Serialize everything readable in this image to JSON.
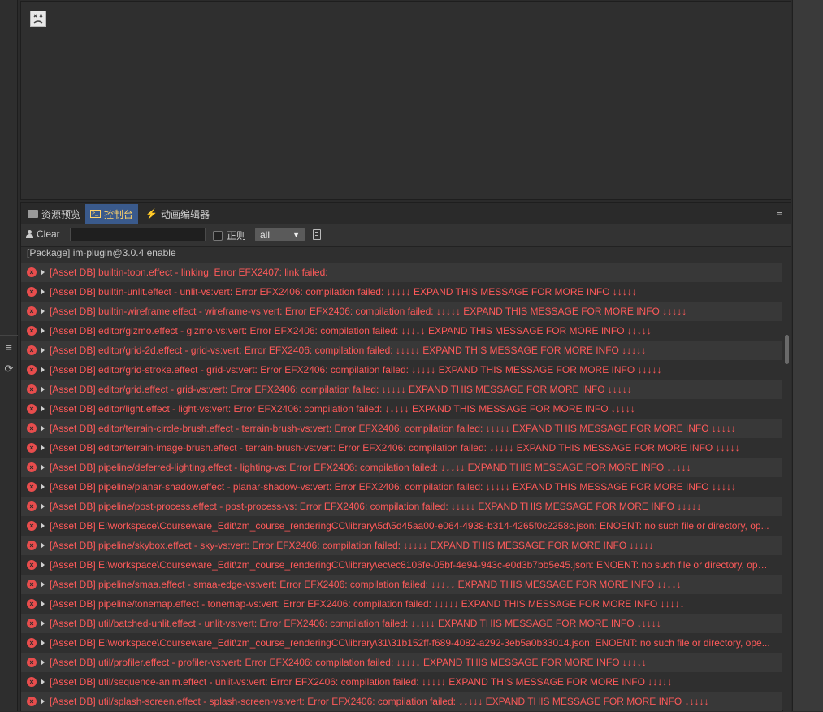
{
  "tabs": [
    {
      "label": "资源预览",
      "icon": "folder-icon"
    },
    {
      "label": "控制台",
      "icon": "console-icon"
    },
    {
      "label": "动画编辑器",
      "icon": "animation-icon"
    }
  ],
  "toolbar": {
    "clear_label": "Clear",
    "search_value": "",
    "regex_label": "正则",
    "filter_selected": "all",
    "menu_glyph": "≡"
  },
  "logs": [
    {
      "type": "info",
      "text": "[Package] im-plugin@3.0.4 enable"
    },
    {
      "type": "error",
      "text": "[Asset DB] builtin-toon.effect - linking: Error EFX2407: link failed:"
    },
    {
      "type": "error",
      "text": "[Asset DB] builtin-unlit.effect - unlit-vs:vert: Error EFX2406: compilation failed: ↓↓↓↓↓ EXPAND THIS MESSAGE FOR MORE INFO ↓↓↓↓↓"
    },
    {
      "type": "error",
      "text": "[Asset DB] builtin-wireframe.effect - wireframe-vs:vert: Error EFX2406: compilation failed: ↓↓↓↓↓ EXPAND THIS MESSAGE FOR MORE INFO ↓↓↓↓↓"
    },
    {
      "type": "error",
      "text": "[Asset DB] editor/gizmo.effect - gizmo-vs:vert: Error EFX2406: compilation failed: ↓↓↓↓↓ EXPAND THIS MESSAGE FOR MORE INFO ↓↓↓↓↓"
    },
    {
      "type": "error",
      "text": "[Asset DB] editor/grid-2d.effect - grid-vs:vert: Error EFX2406: compilation failed: ↓↓↓↓↓ EXPAND THIS MESSAGE FOR MORE INFO ↓↓↓↓↓"
    },
    {
      "type": "error",
      "text": "[Asset DB] editor/grid-stroke.effect - grid-vs:vert: Error EFX2406: compilation failed: ↓↓↓↓↓ EXPAND THIS MESSAGE FOR MORE INFO ↓↓↓↓↓"
    },
    {
      "type": "error",
      "text": "[Asset DB] editor/grid.effect - grid-vs:vert: Error EFX2406: compilation failed: ↓↓↓↓↓ EXPAND THIS MESSAGE FOR MORE INFO ↓↓↓↓↓"
    },
    {
      "type": "error",
      "text": "[Asset DB] editor/light.effect - light-vs:vert: Error EFX2406: compilation failed: ↓↓↓↓↓ EXPAND THIS MESSAGE FOR MORE INFO ↓↓↓↓↓"
    },
    {
      "type": "error",
      "text": "[Asset DB] editor/terrain-circle-brush.effect - terrain-brush-vs:vert: Error EFX2406: compilation failed: ↓↓↓↓↓ EXPAND THIS MESSAGE FOR MORE INFO ↓↓↓↓↓"
    },
    {
      "type": "error",
      "text": "[Asset DB] editor/terrain-image-brush.effect - terrain-brush-vs:vert: Error EFX2406: compilation failed: ↓↓↓↓↓ EXPAND THIS MESSAGE FOR MORE INFO ↓↓↓↓↓"
    },
    {
      "type": "error",
      "text": "[Asset DB] pipeline/deferred-lighting.effect - lighting-vs: Error EFX2406: compilation failed: ↓↓↓↓↓ EXPAND THIS MESSAGE FOR MORE INFO ↓↓↓↓↓"
    },
    {
      "type": "error",
      "text": "[Asset DB] pipeline/planar-shadow.effect - planar-shadow-vs:vert: Error EFX2406: compilation failed: ↓↓↓↓↓ EXPAND THIS MESSAGE FOR MORE INFO ↓↓↓↓↓"
    },
    {
      "type": "error",
      "text": "[Asset DB] pipeline/post-process.effect - post-process-vs: Error EFX2406: compilation failed: ↓↓↓↓↓ EXPAND THIS MESSAGE FOR MORE INFO ↓↓↓↓↓"
    },
    {
      "type": "error",
      "text": "[Asset DB] E:\\workspace\\Courseware_Edit\\zm_course_renderingCC\\library\\5d\\5d45aa00-e064-4938-b314-4265f0c2258c.json: ENOENT: no such file or directory, op..."
    },
    {
      "type": "error",
      "text": "[Asset DB] pipeline/skybox.effect - sky-vs:vert: Error EFX2406: compilation failed: ↓↓↓↓↓ EXPAND THIS MESSAGE FOR MORE INFO ↓↓↓↓↓"
    },
    {
      "type": "error",
      "text": "[Asset DB] E:\\workspace\\Courseware_Edit\\zm_course_renderingCC\\library\\ec\\ec8106fe-05bf-4e94-943c-e0d3b7bb5e45.json: ENOENT: no such file or directory, ope..."
    },
    {
      "type": "error",
      "text": "[Asset DB] pipeline/smaa.effect - smaa-edge-vs:vert: Error EFX2406: compilation failed: ↓↓↓↓↓ EXPAND THIS MESSAGE FOR MORE INFO ↓↓↓↓↓"
    },
    {
      "type": "error",
      "text": "[Asset DB] pipeline/tonemap.effect - tonemap-vs:vert: Error EFX2406: compilation failed: ↓↓↓↓↓ EXPAND THIS MESSAGE FOR MORE INFO ↓↓↓↓↓"
    },
    {
      "type": "error",
      "text": "[Asset DB] util/batched-unlit.effect - unlit-vs:vert: Error EFX2406: compilation failed: ↓↓↓↓↓ EXPAND THIS MESSAGE FOR MORE INFO ↓↓↓↓↓"
    },
    {
      "type": "error",
      "text": "[Asset DB] E:\\workspace\\Courseware_Edit\\zm_course_renderingCC\\library\\31\\31b152ff-f689-4082-a292-3eb5a0b33014.json: ENOENT: no such file or directory, ope..."
    },
    {
      "type": "error",
      "text": "[Asset DB] util/profiler.effect - profiler-vs:vert: Error EFX2406: compilation failed: ↓↓↓↓↓ EXPAND THIS MESSAGE FOR MORE INFO ↓↓↓↓↓"
    },
    {
      "type": "error",
      "text": "[Asset DB] util/sequence-anim.effect - unlit-vs:vert: Error EFX2406: compilation failed: ↓↓↓↓↓ EXPAND THIS MESSAGE FOR MORE INFO ↓↓↓↓↓"
    },
    {
      "type": "error",
      "text": "[Asset DB] util/splash-screen.effect - splash-screen-vs:vert: Error EFX2406: compilation failed: ↓↓↓↓↓ EXPAND THIS MESSAGE FOR MORE INFO ↓↓↓↓↓"
    }
  ],
  "colors": {
    "error_text": "#ff5a5a",
    "active_tab_bg": "#3a5a8c",
    "active_tab_text": "#ffd36a"
  }
}
